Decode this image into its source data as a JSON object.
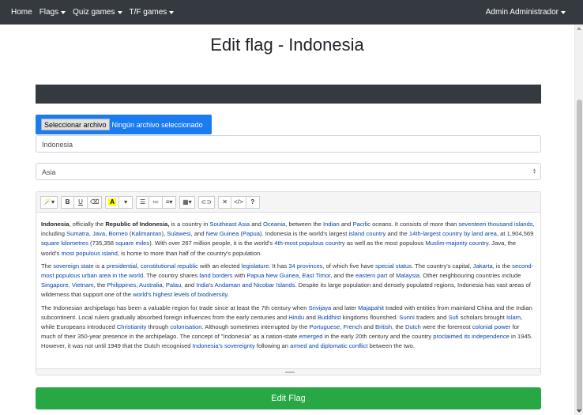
{
  "nav": {
    "home": "Home",
    "flags": "Flags",
    "quiz_games": "Quiz games",
    "tf_games": "T/F games",
    "user": "Admin Administrador"
  },
  "page_title": "Edit flag - Indonesia",
  "file_input": {
    "button_label": "Seleccionar archivo",
    "status": "Ningún archivo seleccionado"
  },
  "name_input": {
    "value": "Indonesia"
  },
  "continent_select": {
    "selected": "Asia"
  },
  "toolbar": {
    "style_icon": "magic-icon",
    "bold": "B",
    "underline": "U",
    "eraser_icon": "eraser-icon",
    "color": "A",
    "ul_icon": "unordered-list-icon",
    "ol_icon": "ordered-list-icon",
    "align_icon": "align-icon",
    "table_icon": "table-icon",
    "link_icon": "link-icon",
    "fullscreen_icon": "fullscreen-icon",
    "code_view": "</>",
    "help": "?"
  },
  "colors": {
    "navbar": "#343a40",
    "file_blue": "#1a7cf0",
    "submit_green": "#28a745",
    "link": "#0645ad"
  },
  "submit_label": "Edit Flag"
}
